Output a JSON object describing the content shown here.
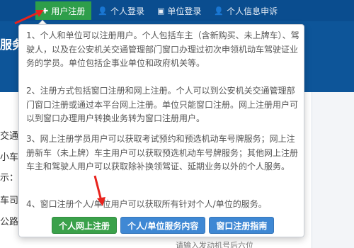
{
  "nav": {
    "tabs": [
      {
        "label": "用户注册",
        "icon": "plus-icon",
        "active": true
      },
      {
        "label": "个人登录",
        "icon": "user-icon",
        "active": false
      },
      {
        "label": "单位登录",
        "icon": "document-icon",
        "active": false
      },
      {
        "label": "个人信息申诉",
        "icon": "user-icon",
        "active": false
      }
    ]
  },
  "background": {
    "side_title_fragment": "服务",
    "left_fragments": [
      "交通",
      "小车",
      "示：",
      "车司",
      "公路"
    ],
    "bottom_fragment": "请输入发动机号后六位"
  },
  "popover": {
    "paragraphs": [
      "1、个人和单位可以注册用户。个人包括车主（含新购买、未上牌车）、驾驶人，以及在公安机关交通管理部门窗口办理过初次申领机动车驾驶证业务的学员。单位包括企事业单位和政府机关等。",
      "2、注册方式包括窗口注册和网上注册。个人可以到公安机关交通管理部门窗口注册或通过本平台网上注册。单位只能窗口注册。网上注册用户可以到窗口办理用户转换业务转为窗口注册用户。",
      "3、网上注册学员用户可以获取考试预约和预选机动车号牌服务；网上注册新车（未上牌）车主用户可以获取预选机动车号牌服务；其他网上注册车主和驾驶人用户可以获取除补换领驾证、延期业务以外的个人服务。",
      "4、窗口注册个人/单位用户可以获取所有针对个人/单位的服务。"
    ],
    "buttons": {
      "personal_online": "个人网上注册",
      "service_content": "个人/单位服务内容",
      "window_guide": "窗口注册指南"
    }
  },
  "colors": {
    "nav_bg": "#0a4d8f",
    "active_tab": "#2e9e4a",
    "green_button": "#3aa14a",
    "blue_button": "#3f88d4",
    "annotation_arrow": "#e8231d"
  }
}
